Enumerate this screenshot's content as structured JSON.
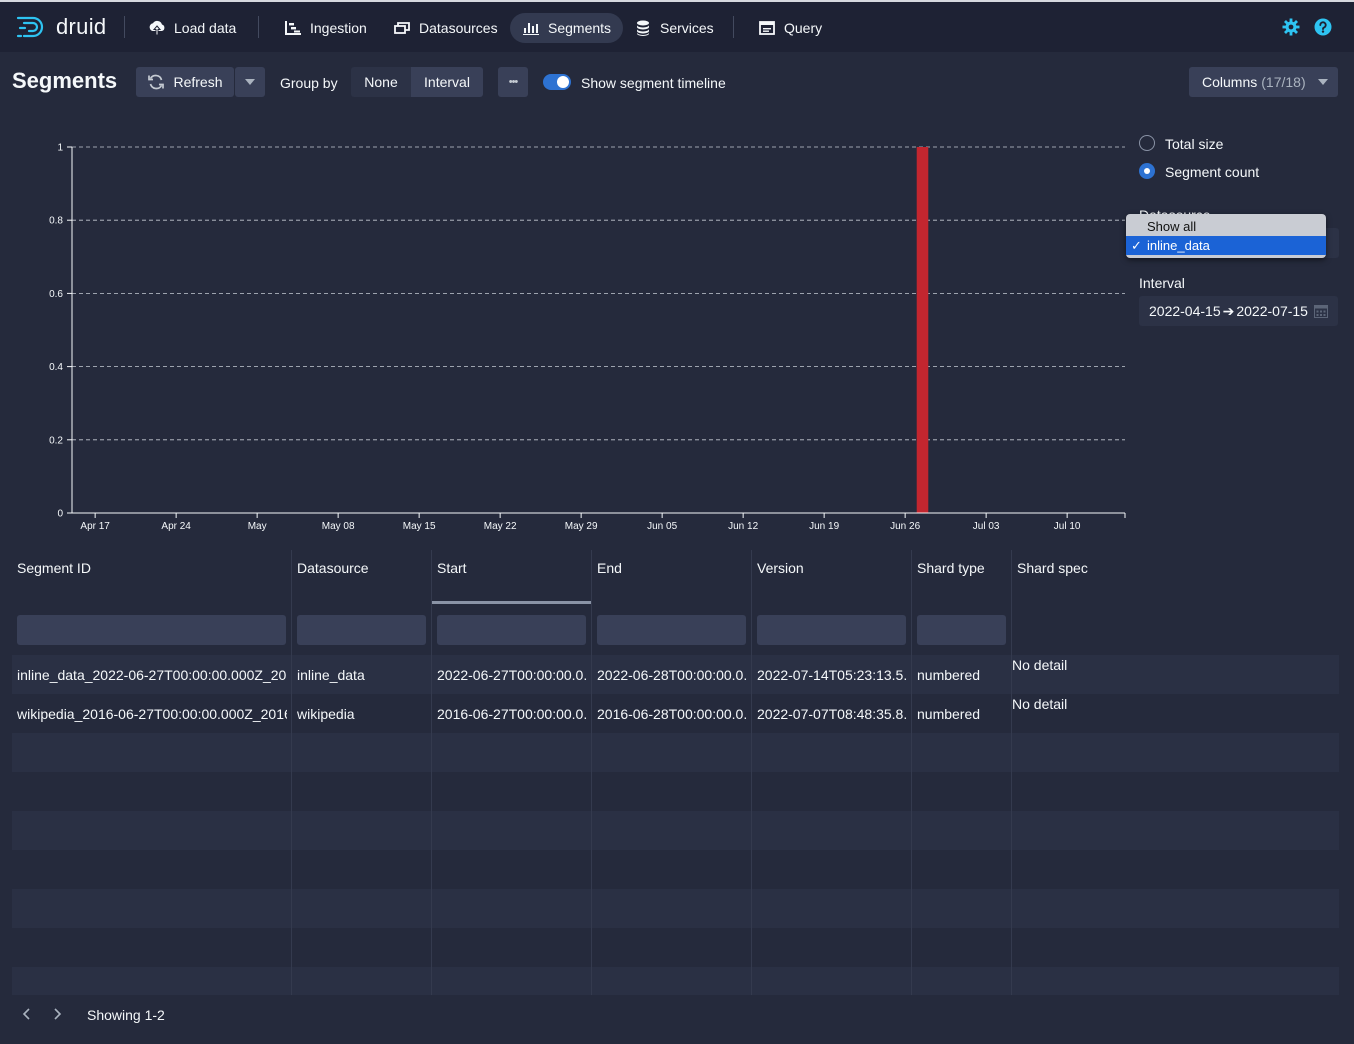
{
  "app": {
    "logo_text": "druid"
  },
  "nav": {
    "items": [
      {
        "label": "Load data",
        "icon": "cloud-upload-icon"
      },
      {
        "label": "Ingestion",
        "icon": "gantt-chart-icon"
      },
      {
        "label": "Datasources",
        "icon": "multi-select-icon"
      },
      {
        "label": "Segments",
        "icon": "stacked-chart-icon",
        "active": true
      },
      {
        "label": "Services",
        "icon": "database-icon"
      },
      {
        "label": "Query",
        "icon": "application-icon"
      }
    ],
    "right_icons": [
      "cog-icon",
      "help-icon"
    ]
  },
  "toolbar": {
    "title": "Segments",
    "refresh_label": "Refresh",
    "group_by_label": "Group by",
    "group_none": "None",
    "group_interval": "Interval",
    "group_selected": "Interval",
    "more_label": "•••",
    "timeline_toggle_label": "Show segment timeline",
    "timeline_toggle_on": true,
    "columns_label": "Columns",
    "columns_count": "(17/18)"
  },
  "controls": {
    "metric_options": [
      "Total size",
      "Segment count"
    ],
    "metric_selected": "Segment count",
    "datasource_label": "Datasource",
    "datasource_options": [
      "Show all",
      "inline_data"
    ],
    "datasource_selected": "inline_data",
    "interval_label": "Interval",
    "interval_start": "2022-04-15",
    "interval_arrow": "➔",
    "interval_end": "2022-07-15"
  },
  "chart_data": {
    "type": "bar",
    "x_axis_type": "time",
    "xlim": [
      "2022-04-15",
      "2022-07-15"
    ],
    "x_tick_dates": [
      "2022-04-17",
      "2022-04-24",
      "2022-05-01",
      "2022-05-08",
      "2022-05-15",
      "2022-05-22",
      "2022-05-29",
      "2022-06-05",
      "2022-06-12",
      "2022-06-19",
      "2022-06-26",
      "2022-07-03",
      "2022-07-10"
    ],
    "x_tick_labels": [
      "Apr 17",
      "Apr 24",
      "May",
      "May 08",
      "May 15",
      "May 22",
      "May 29",
      "Jun 05",
      "Jun 12",
      "Jun 19",
      "Jun 26",
      "Jul 03",
      "Jul 10"
    ],
    "y_ticks": [
      0,
      0.2,
      0.4,
      0.6,
      0.8,
      1
    ],
    "y_tick_labels": [
      "0",
      "0.2",
      "0.4",
      "0.6",
      "0.8",
      "1"
    ],
    "ylim": [
      0,
      1
    ],
    "grid": "horizontal-dashed",
    "bar_color": "#c3262f",
    "series": [
      {
        "values": [
          {
            "start": "2022-06-27",
            "end": "2022-06-28",
            "value": 1
          }
        ]
      }
    ]
  },
  "table": {
    "columns": [
      "Segment ID",
      "Datasource",
      "Start",
      "End",
      "Version",
      "Shard type",
      "Shard spec"
    ],
    "sorted_column": "Start",
    "rows": [
      [
        "inline_data_2022-06-27T00:00:00.000Z_20...",
        "inline_data",
        "2022-06-27T00:00:00.0...",
        "2022-06-28T00:00:00.0...",
        "2022-07-14T05:23:13.5...",
        "numbered",
        "No detail"
      ],
      [
        "wikipedia_2016-06-27T00:00:00.000Z_2016...",
        "wikipedia",
        "2016-06-27T00:00:00.0...",
        "2016-06-28T00:00:00.0...",
        "2022-07-07T08:48:35.8...",
        "numbered",
        "No detail"
      ]
    ]
  },
  "pagination": {
    "showing": "Showing 1-2"
  }
}
